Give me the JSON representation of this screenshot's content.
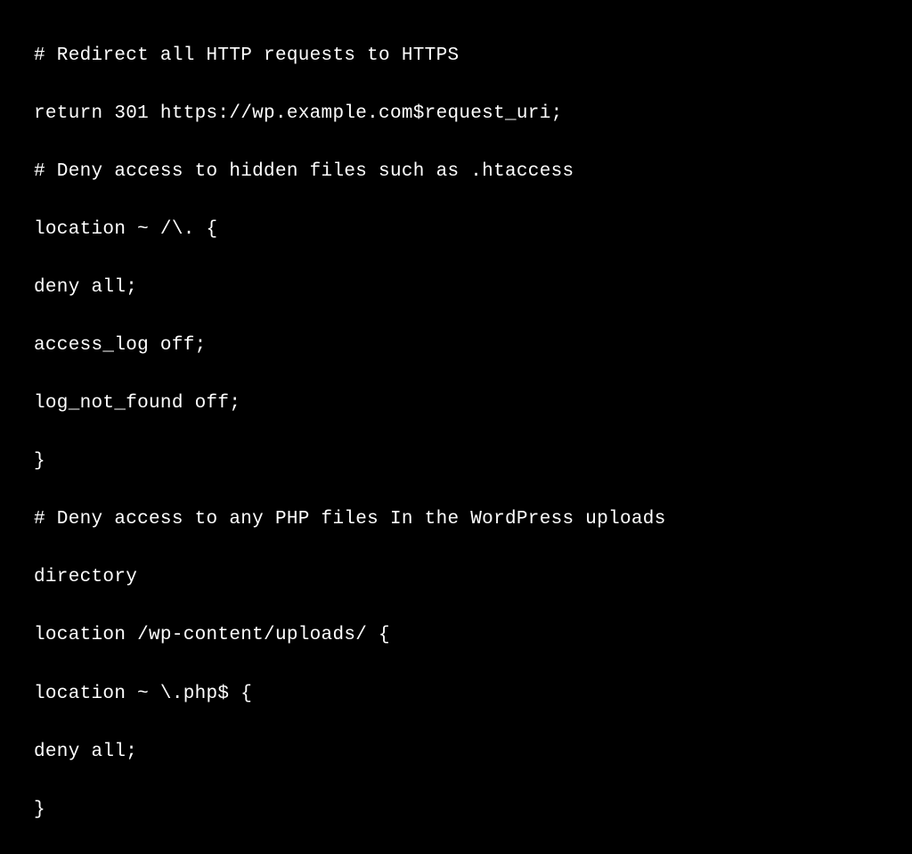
{
  "code": {
    "lines": [
      "# Redirect all HTTP requests to HTTPS",
      "return 301 https://wp.example.com$request_uri;",
      "# Deny access to hidden files such as .htaccess",
      "location ~ /\\. {",
      "deny all;",
      "access_log off;",
      "log_not_found off;",
      "}",
      "# Deny access to any PHP files In the WordPress uploads",
      "directory",
      "location /wp-content/uploads/ {",
      "location ~ \\.php$ {",
      "deny all;",
      "}"
    ]
  }
}
